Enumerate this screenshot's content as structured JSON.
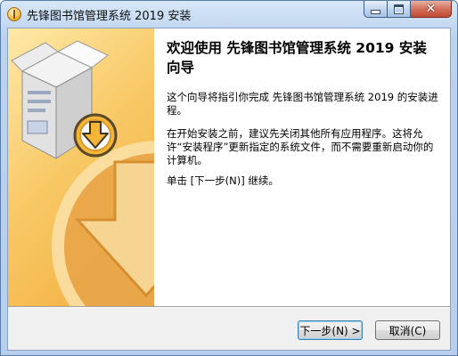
{
  "window": {
    "title": "先锋图书馆管理系统 2019 安装",
    "controls": {
      "minimize": "minimize",
      "maximize": "maximize",
      "close": "✕"
    }
  },
  "wizard": {
    "heading": "欢迎使用 先锋图书馆管理系统 2019 安装向导",
    "paragraph1": "这个向导将指引你完成 先锋图书馆管理系统 2019 的安装进程。",
    "paragraph2": "在开始安装之前，建议先关闭其他所有应用程序。这将允许“安装程序”更新指定的系统文件，而不需要重新启动你的计算机。",
    "paragraph3": "单击 [下一步(N)] 继续。"
  },
  "buttons": {
    "next": "下一步(N) >",
    "cancel": "取消(C)"
  },
  "colors": {
    "banner_top": "#ffe9a8",
    "banner_bottom": "#f2ad3a",
    "titlebar": "#bcd3ee",
    "close_button": "#c24a33"
  },
  "icons": [
    "installer-app-icon",
    "software-box-icon",
    "download-arrow-icon"
  ]
}
